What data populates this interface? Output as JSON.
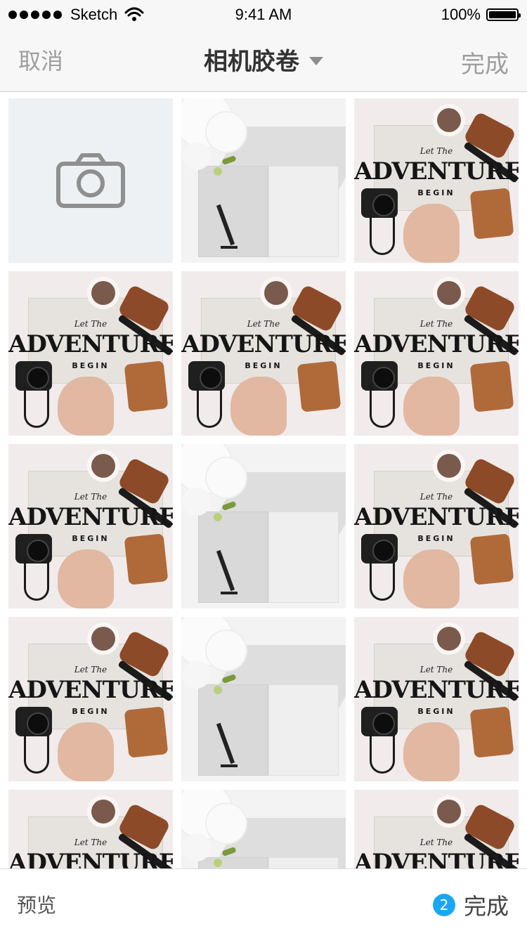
{
  "status_bar": {
    "carrier": "Sketch",
    "time": "9:41 AM",
    "battery": "100%"
  },
  "nav": {
    "cancel": "取消",
    "title": "相机胶卷",
    "done": "完成"
  },
  "grid": {
    "first_tile": "camera",
    "adventure_text": {
      "small": "Let The",
      "headline": "ADVENTURE",
      "sub": "BEGIN"
    }
  },
  "toolbar": {
    "preview": "预览",
    "selected_count": "2",
    "done": "完成"
  },
  "colors": {
    "accent": "#1aa7f2",
    "nav_text": "#9e9e9e"
  }
}
